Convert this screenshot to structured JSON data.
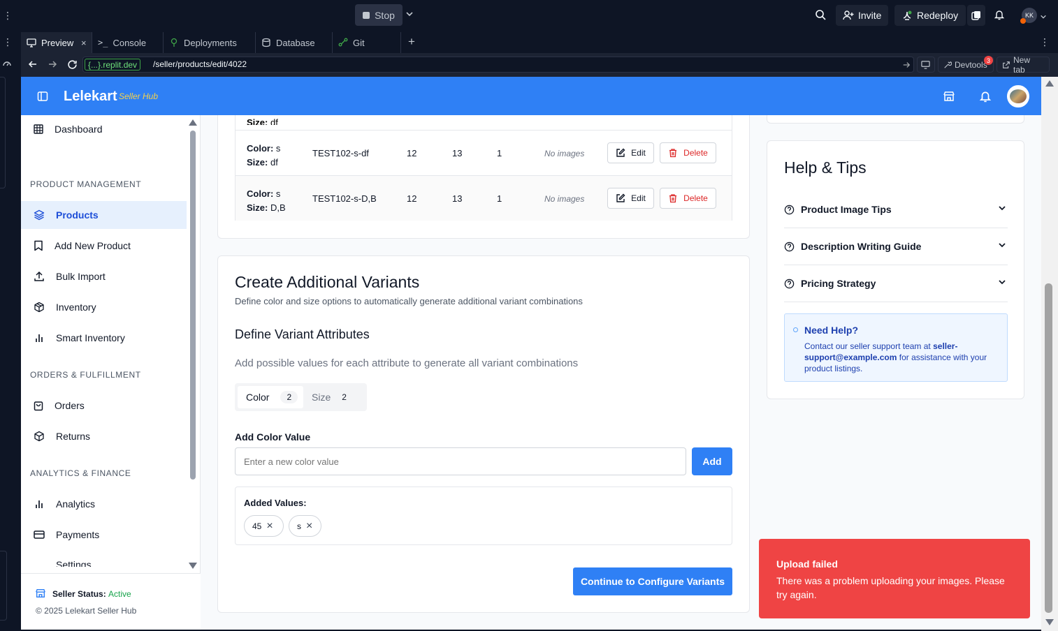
{
  "replit": {
    "stop_label": "Stop",
    "invite_label": "Invite",
    "redeploy_label": "Redeploy",
    "avatar_initials": "KK",
    "tabs": [
      {
        "label": "Preview"
      },
      {
        "label": "Console"
      },
      {
        "label": "Deployments"
      },
      {
        "label": "Database"
      },
      {
        "label": "Git"
      }
    ],
    "url_domain": "{...}.replit.dev",
    "url_path": "/seller/products/edit/4022",
    "devtools_label": "Devtools",
    "devtools_badge": "3",
    "newtab_label": "New tab"
  },
  "header": {
    "brand": "Lelekart",
    "brand_sub": "Seller Hub"
  },
  "sidebar": {
    "dashboard": "Dashboard",
    "section_product": "PRODUCT MANAGEMENT",
    "products": "Products",
    "add_new_product": "Add New Product",
    "bulk_import": "Bulk Import",
    "inventory": "Inventory",
    "smart_inventory": "Smart Inventory",
    "section_orders": "ORDERS & FULFILLMENT",
    "orders": "Orders",
    "returns": "Returns",
    "section_analytics": "ANALYTICS & FINANCE",
    "analytics": "Analytics",
    "payments": "Payments",
    "settings_partial": "Settings",
    "seller_status_label": "Seller Status:",
    "seller_status_value": "Active",
    "copyright": "© 2025 Lelekart Seller Hub"
  },
  "variants_table": {
    "partial_row_size_label": "Size:",
    "partial_row_size_value": "df",
    "rows": [
      {
        "color_label": "Color:",
        "color": "s",
        "size_label": "Size:",
        "size": "df",
        "sku": "TEST102-s-df",
        "price": "12",
        "mrp": "13",
        "stock": "1",
        "images": "No images",
        "edit": "Edit",
        "delete": "Delete"
      },
      {
        "color_label": "Color:",
        "color": "s",
        "size_label": "Size:",
        "size": "D,B",
        "sku": "TEST102-s-D,B",
        "price": "12",
        "mrp": "13",
        "stock": "1",
        "images": "No images",
        "edit": "Edit",
        "delete": "Delete"
      }
    ]
  },
  "create_variants": {
    "title": "Create Additional Variants",
    "subtitle": "Define color and size options to automatically generate additional variant combinations",
    "attr_title": "Define Variant Attributes",
    "attr_subtitle": "Add possible values for each attribute to generate all variant combinations",
    "tabs": [
      {
        "label": "Color",
        "count": "2"
      },
      {
        "label": "Size",
        "count": "2"
      }
    ],
    "add_label": "Add Color Value",
    "input_placeholder": "Enter a new color value",
    "add_button": "Add",
    "added_values_label": "Added Values:",
    "values": [
      "45",
      "s"
    ],
    "continue_button": "Continue to Configure Variants"
  },
  "help": {
    "title": "Help & Tips",
    "items": [
      "Product Image Tips",
      "Description Writing Guide",
      "Pricing Strategy"
    ],
    "need_help_title": "Need Help?",
    "need_help_text_1": "Contact our seller support team at",
    "need_help_email": "seller-support@example.com",
    "need_help_text_2": "for assistance with your product listings."
  },
  "toast": {
    "title": "Upload failed",
    "message": "There was a problem uploading your images. Please try again.",
    "color": "#ef4444"
  },
  "colors": {
    "brand_blue": "#2f80f5",
    "brand_sub_yellow": "#f6d24a",
    "active_green": "#16a34a",
    "delete_red": "#dc2626"
  }
}
